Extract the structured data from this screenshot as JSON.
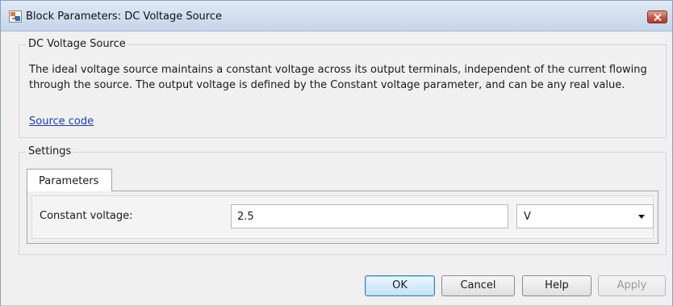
{
  "window": {
    "title": "Block Parameters: DC Voltage Source"
  },
  "description_group": {
    "label": "DC Voltage Source",
    "text": "The ideal voltage source maintains a constant voltage across its output terminals, independent of the current flowing through the source. The output voltage is defined by the Constant voltage parameter, and can be any real value.",
    "link_text": "Source code"
  },
  "settings_group": {
    "label": "Settings",
    "tabs": [
      {
        "label": "Parameters",
        "active": true
      }
    ],
    "parameters": [
      {
        "label": "Constant voltage:",
        "value": "2.5",
        "unit": "V"
      }
    ]
  },
  "buttons": {
    "ok": "OK",
    "cancel": "Cancel",
    "help": "Help",
    "apply": "Apply"
  },
  "icons": {
    "app": "simulink-block-icon",
    "close": "close-icon",
    "dropdown": "chevron-down-icon"
  },
  "colors": {
    "link": "#1a3fb4",
    "close_button": "#c75441",
    "default_button": "#3c7fb1"
  }
}
